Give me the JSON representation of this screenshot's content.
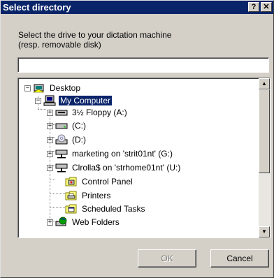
{
  "window": {
    "title": "Select directory",
    "help_glyph": "?",
    "close_glyph": "✕"
  },
  "prompt": {
    "line1": "Select the drive to your dictation machine",
    "line2": "(resp. removable disk)"
  },
  "path_input": {
    "value": ""
  },
  "tree": {
    "items": [
      {
        "label": "Desktop",
        "icon": "desktop-icon",
        "expander": "−"
      },
      {
        "label": "My Computer",
        "icon": "computer-icon",
        "expander": "−",
        "selected": true
      },
      {
        "label": "3½ Floppy (A:)",
        "icon": "floppy-drive-icon",
        "expander": "+"
      },
      {
        "label": "(C:)",
        "icon": "hard-drive-icon",
        "expander": "+"
      },
      {
        "label": "(D:)",
        "icon": "cd-drive-icon",
        "expander": "+"
      },
      {
        "label": "marketing on 'strit01nt' (G:)",
        "icon": "network-drive-icon",
        "expander": "+"
      },
      {
        "label": "Clrolla$ on 'strhome01nt' (U:)",
        "icon": "network-drive-icon",
        "expander": "+"
      },
      {
        "label": "Control Panel",
        "icon": "control-panel-icon"
      },
      {
        "label": "Printers",
        "icon": "printers-folder-icon"
      },
      {
        "label": "Scheduled Tasks",
        "icon": "scheduled-tasks-icon"
      },
      {
        "label": "Web Folders",
        "icon": "web-folders-icon",
        "expander": "+"
      }
    ]
  },
  "scrollbar": {
    "up_glyph": "▲",
    "down_glyph": "▼"
  },
  "buttons": {
    "ok": "OK",
    "cancel": "Cancel"
  },
  "colors": {
    "title_bar": "#0a246a",
    "face": "#d4d0c8",
    "selection": "#0a246a"
  }
}
